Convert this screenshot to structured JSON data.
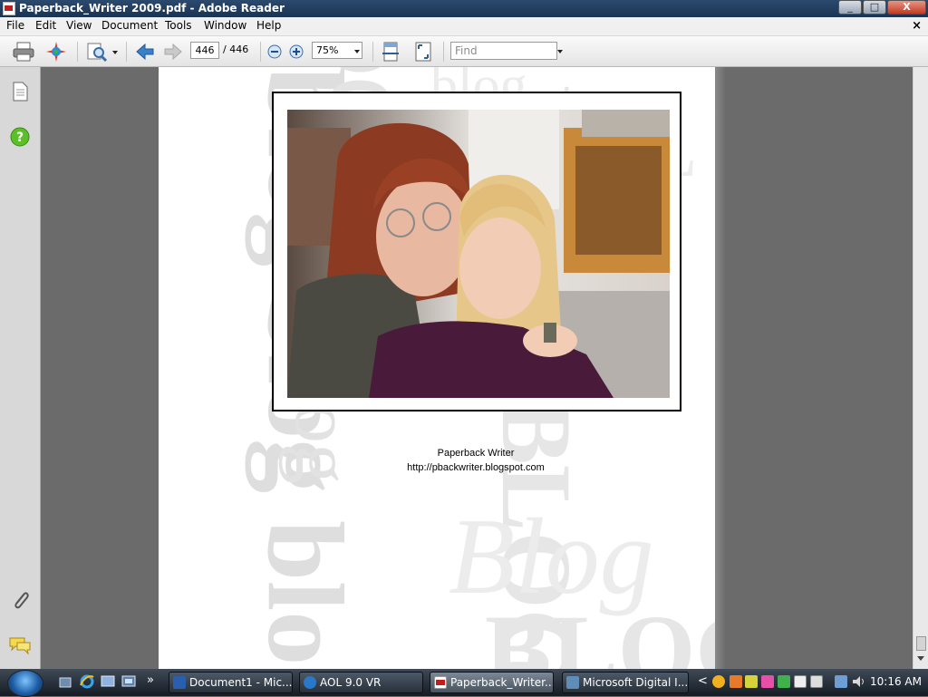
{
  "window": {
    "title": "Paperback_Writer 2009.pdf - Adobe Reader",
    "min": "_",
    "max": "□",
    "close": "X"
  },
  "menubar": {
    "items": [
      "File",
      "Edit",
      "View",
      "Document",
      "Tools",
      "Window",
      "Help"
    ],
    "close": "×"
  },
  "toolbar": {
    "current_page": "446",
    "total_pages": "/ 446",
    "zoom": "75%",
    "find_placeholder": "Find"
  },
  "document": {
    "caption_line1": "Paperback Writer",
    "caption_line2": "http://pbackwriter.blogspot.com"
  },
  "taskbar": {
    "tasks": [
      {
        "label": "Document1 - Mic...",
        "icon": "word-icon"
      },
      {
        "label": "AOL 9.0 VR",
        "icon": "aol-icon"
      },
      {
        "label": "Paperback_Writer...",
        "icon": "pdf-icon",
        "active": true
      },
      {
        "label": "Microsoft Digital I...",
        "icon": "digital-image-icon"
      }
    ],
    "clock": "10:16 AM",
    "more": "»",
    "tray_arrow": "<"
  }
}
